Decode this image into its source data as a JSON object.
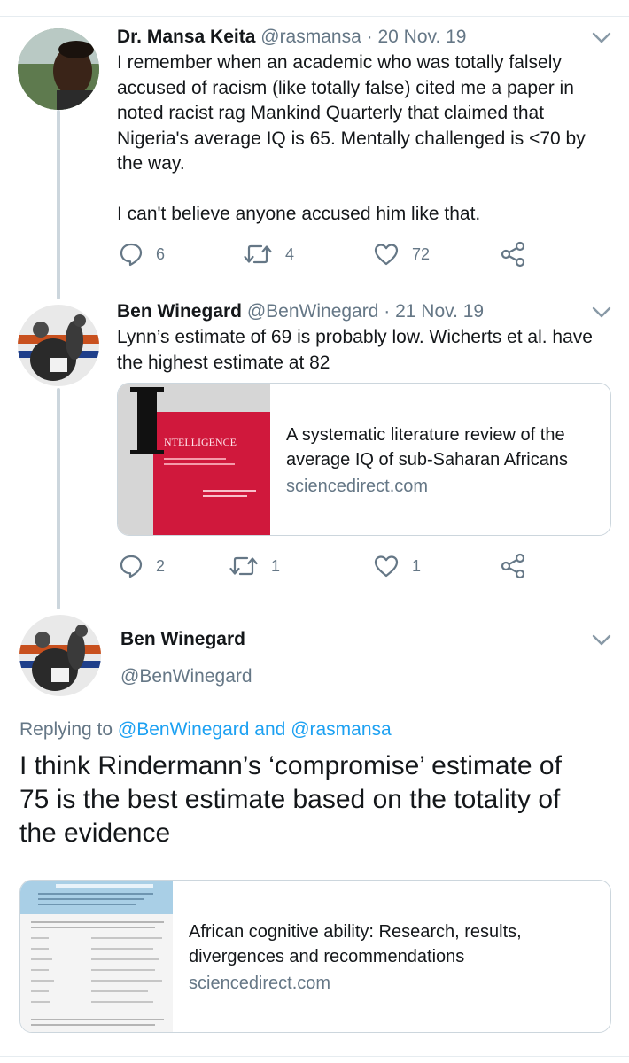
{
  "colors": {
    "text": "#14171a",
    "muted": "#657786",
    "link": "#1da1f2",
    "border": "#ccd6dd"
  },
  "tweets": [
    {
      "name": "Dr. Mansa Keita",
      "handle": "@rasmansa",
      "dot": "·",
      "date": "20 Nov. 19",
      "lines": [
        "I remember when an academic who was totally falsely",
        "accused of racism (like totally false) cited me a paper in",
        "noted racist rag Mankind Quarterly that claimed that",
        "Nigeria's average IQ is 65. Mentally challenged is <70 by",
        "the way."
      ],
      "line2": "I can't believe anyone accused him like that.",
      "replies": "6",
      "retweets": "4",
      "likes": "72"
    },
    {
      "name": "Ben Winegard",
      "handle": "@BenWinegard",
      "dot": "·",
      "date": "21 Nov. 19",
      "lines": [
        "Lynn’s estimate of 69 is probably low. Wicherts et al. have",
        "the highest estimate at 82"
      ],
      "card": {
        "thumb_text": "NTELLIGENCE",
        "title_lines": [
          "A systematic literature review of the",
          "average IQ of sub-Saharan Africans"
        ],
        "domain": "sciencedirect.com"
      },
      "replies": "2",
      "retweets": "1",
      "likes": "1"
    }
  ],
  "focus": {
    "name": "Ben Winegard",
    "handle": "@BenWinegard",
    "replying_prefix": "Replying to ",
    "mention1": "@BenWinegard",
    "and": " and ",
    "mention2": "@rasmansa",
    "lines": [
      "I think Rindermann’s ‘compromise’ estimate of",
      "75 is the best estimate based on the totality of",
      "the evidence"
    ],
    "card": {
      "title_lines": [
        "African cognitive ability: Research, results,",
        "divergences and recommendations"
      ],
      "domain": "sciencedirect.com"
    }
  }
}
